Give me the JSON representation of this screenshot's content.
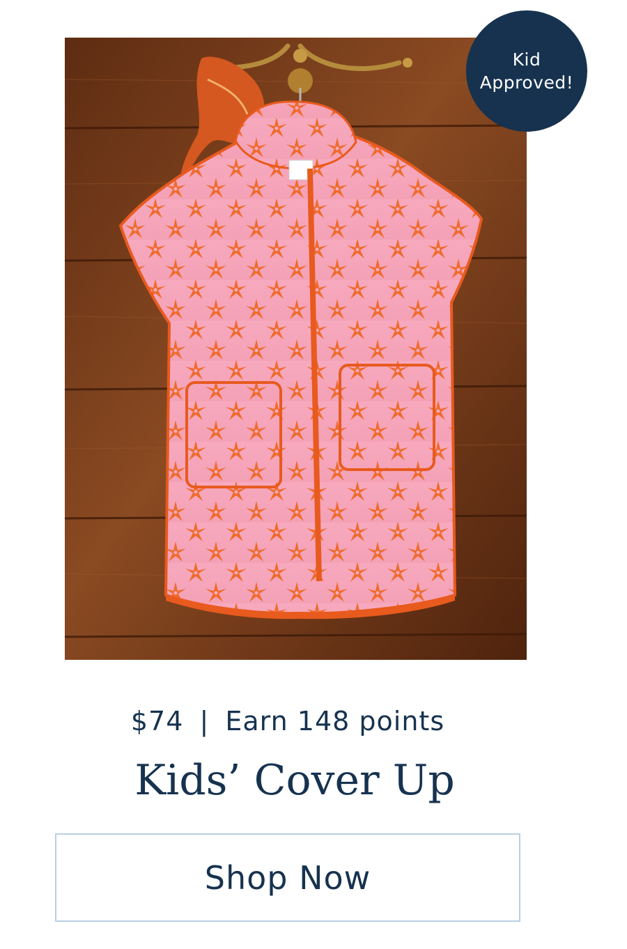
{
  "badge": {
    "line1": "Kid",
    "line2": "Approved!"
  },
  "product": {
    "price": "$74",
    "separator": "|",
    "points": "Earn 148 points",
    "title": "Kids’ Cover Up",
    "image_subject": "pink terry kids cover up with orange flower print on a hanger against wood wall"
  },
  "cta": {
    "label": "Shop Now"
  },
  "colors": {
    "navy": "#16324f",
    "button_border": "#b8cfe2",
    "wood": "#7a3f1c",
    "garment_pink": "#f5a3b8",
    "flower_orange": "#ef6b2c"
  }
}
